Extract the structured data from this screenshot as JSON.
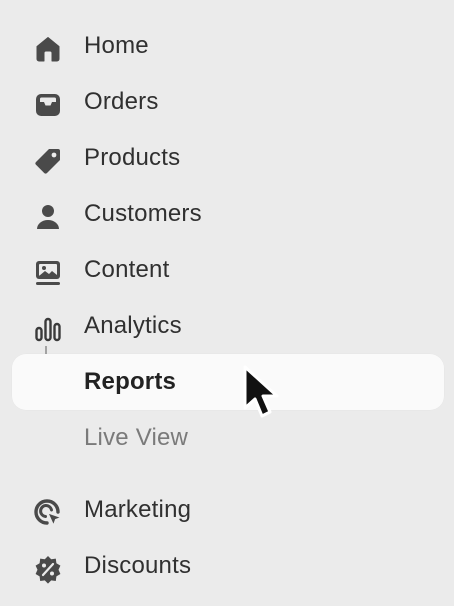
{
  "nav": {
    "items": [
      {
        "label": "Home",
        "icon": "home-icon"
      },
      {
        "label": "Orders",
        "icon": "inbox-icon"
      },
      {
        "label": "Products",
        "icon": "tag-icon"
      },
      {
        "label": "Customers",
        "icon": "person-icon"
      },
      {
        "label": "Content",
        "icon": "image-icon"
      },
      {
        "label": "Analytics",
        "icon": "bar-chart-icon"
      }
    ],
    "sub_items": [
      {
        "label": "Reports",
        "active": true
      },
      {
        "label": "Live View",
        "active": false
      }
    ],
    "more_items": [
      {
        "label": "Marketing",
        "icon": "target-icon"
      },
      {
        "label": "Discounts",
        "icon": "percent-badge-icon"
      }
    ]
  },
  "colors": {
    "background": "#ebebeb",
    "active_background": "#fafafa",
    "text": "#303030",
    "muted_text": "#7a7a7a",
    "icon": "#4a4a4a"
  }
}
